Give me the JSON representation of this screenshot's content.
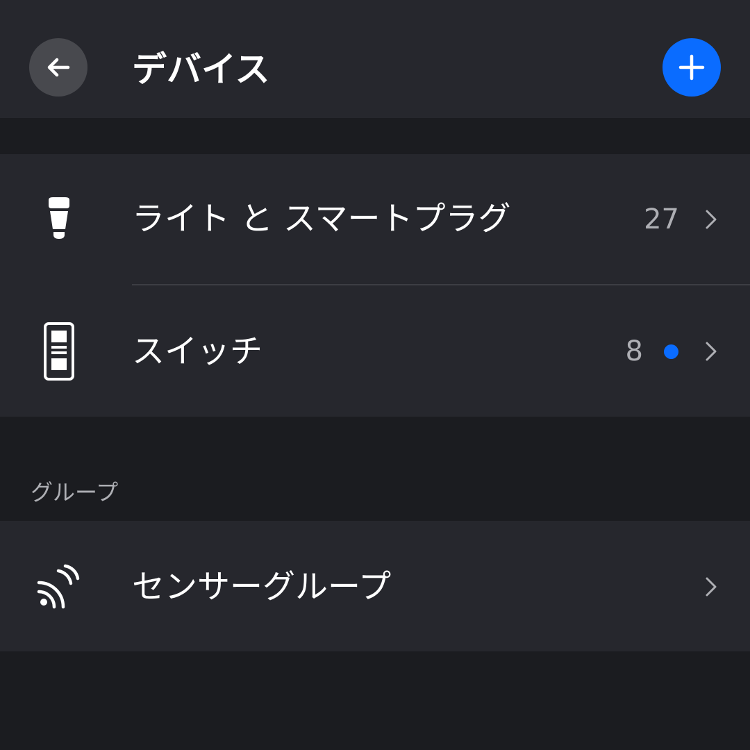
{
  "header": {
    "title": "デバイス",
    "back_icon": "arrow-left-icon",
    "add_icon": "plus-icon"
  },
  "devices": {
    "items": [
      {
        "label": "ライト と スマートプラグ",
        "count": "27",
        "icon": "bulb-icon"
      },
      {
        "label": "スイッチ",
        "count": "8",
        "icon": "switch-icon",
        "has_status_dot": true
      }
    ]
  },
  "groups": {
    "section_label": "グループ",
    "items": [
      {
        "label": "センサーグループ",
        "icon": "sensor-waves-icon"
      }
    ]
  },
  "colors": {
    "accent": "#0a6cff",
    "background": "#1b1c20",
    "surface": "#26272d",
    "secondary_text": "#aeafb4"
  }
}
